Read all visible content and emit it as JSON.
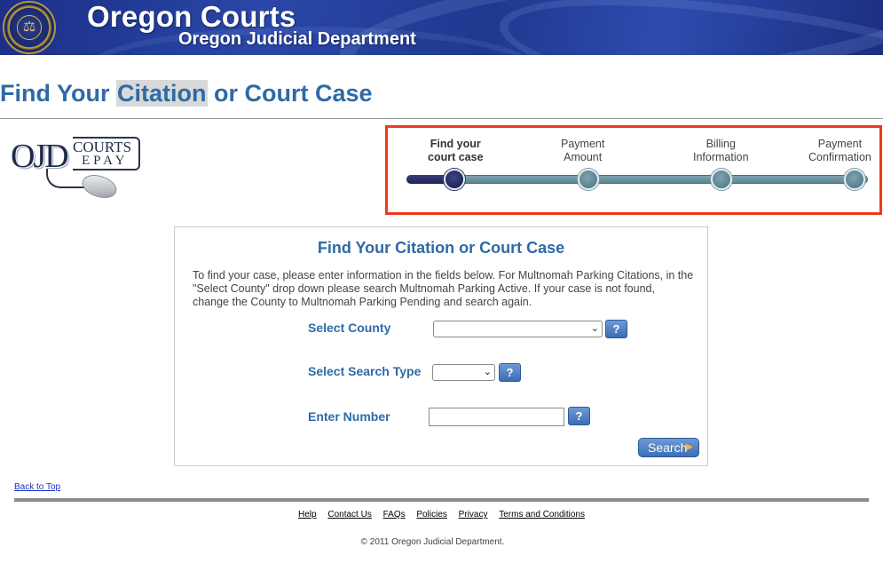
{
  "header": {
    "title": "Oregon Courts",
    "subtitle": "Oregon Judicial Department",
    "seal_icon": "state-seal-icon"
  },
  "page": {
    "title_before": "Find Your ",
    "title_highlight": "Citation",
    "title_after": " or Court Case"
  },
  "logo": {
    "ojd": "OJD",
    "courts": "COURTS",
    "epay": "EPAY"
  },
  "progress": {
    "steps": [
      {
        "line1": "Find your",
        "line2": "court case",
        "active": true
      },
      {
        "line1": "Payment",
        "line2": "Amount",
        "active": false
      },
      {
        "line1": "Billing",
        "line2": "Information",
        "active": false
      },
      {
        "line1": "Payment",
        "line2": "Confirmation",
        "active": false
      }
    ],
    "current_step": 1,
    "highlight_color": "#ee3a1c"
  },
  "form": {
    "title": "Find Your Citation or Court Case",
    "description": "To find your case, please enter information in the fields below. For Multnomah Parking Citations, in the \"Select County\" drop down please search Multnomah Parking Active. If your case is not found, change the County to Multnomah Parking Pending and search again.",
    "county_label": "Select County",
    "county_value": "",
    "search_type_label": "Select Search Type",
    "search_type_value": "",
    "number_label": "Enter Number",
    "number_value": "",
    "help_label": "?",
    "search_button": "Search"
  },
  "footer": {
    "back_to_top": "Back to Top",
    "links": [
      "Help",
      "Contact Us",
      "FAQs",
      "Policies",
      "Privacy",
      "Terms and Conditions"
    ],
    "copyright": "© 2011 Oregon Judicial Department."
  },
  "colors": {
    "accent": "#2e6aa6",
    "banner": "#20388f"
  }
}
